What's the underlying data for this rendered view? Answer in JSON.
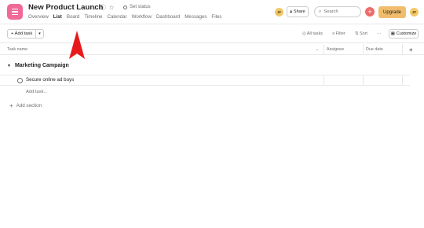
{
  "project": {
    "title": "New Product Launch",
    "set_status": "Set status",
    "tabs": [
      "Overview",
      "List",
      "Board",
      "Timeline",
      "Calendar",
      "Workflow",
      "Dashboard",
      "Messages",
      "Files"
    ],
    "active_tab": "List"
  },
  "header": {
    "avatar_initials": "JF",
    "share_label": "Share",
    "search_placeholder": "Search",
    "upgrade_label": "Upgrade"
  },
  "toolbar": {
    "add_task_label": "+ Add task",
    "all_tasks_label": "All tasks",
    "filter_label": "Filter",
    "sort_label": "Sort",
    "more_label": "···",
    "customize_label": "Customize"
  },
  "columns": {
    "task_name": "Task name",
    "assignee": "Assignee",
    "due_date": "Due date",
    "add_column": "+"
  },
  "sections": [
    {
      "title": "Marketing Campaign",
      "tasks": [
        {
          "name": "Secure online ad buys"
        }
      ]
    }
  ],
  "add_task_link": "Add task...",
  "add_section_label": "Add section",
  "colors": {
    "brand_pink": "#f06a99",
    "upgrade": "#f1bd6c",
    "add_red": "#f06a6a",
    "annotation_arrow": "#e8191b"
  }
}
